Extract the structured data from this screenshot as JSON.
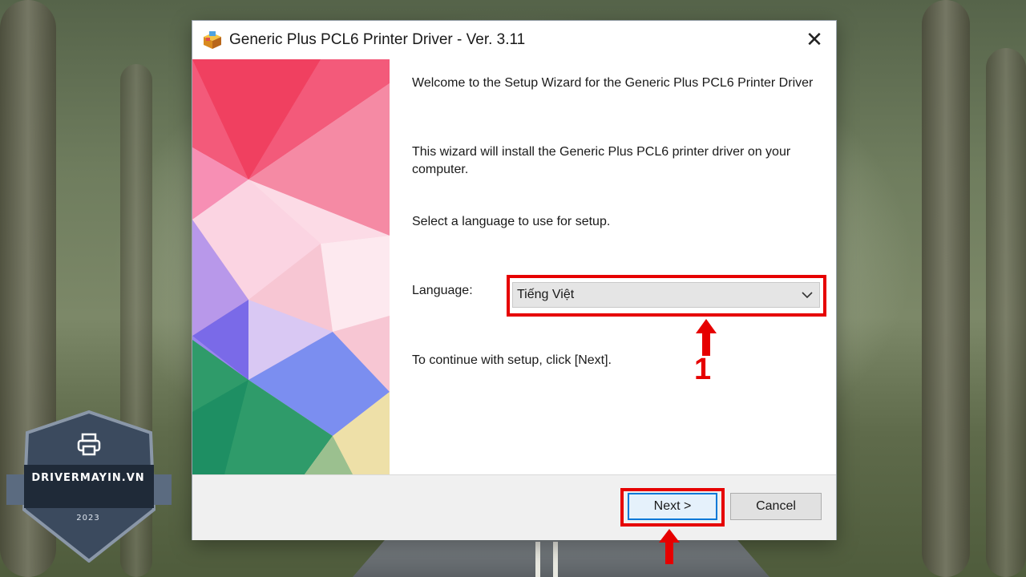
{
  "window": {
    "title": "Generic Plus PCL6 Printer Driver - Ver. 3.11",
    "close_glyph": "✕"
  },
  "content": {
    "welcome": "Welcome to the Setup Wizard for the Generic Plus PCL6 Printer Driver",
    "install_info": "This wizard will install the Generic Plus PCL6 printer driver on your computer.",
    "select_prompt": "Select a language to use for setup.",
    "language_label": "Language:",
    "language_value": "Tiếng Việt",
    "continue_hint": "To continue with setup, click [Next]."
  },
  "buttons": {
    "next": "Next >",
    "cancel": "Cancel"
  },
  "annotations": {
    "step_number": "1",
    "highlight_color": "#e60000"
  },
  "badge": {
    "site": "DRIVERMAYIN.VN",
    "year": "2023",
    "icon": "printer-icon"
  },
  "icons": [
    "installer-box-icon",
    "close-icon",
    "chevron-down-icon",
    "printer-icon",
    "up-arrow-icon"
  ]
}
